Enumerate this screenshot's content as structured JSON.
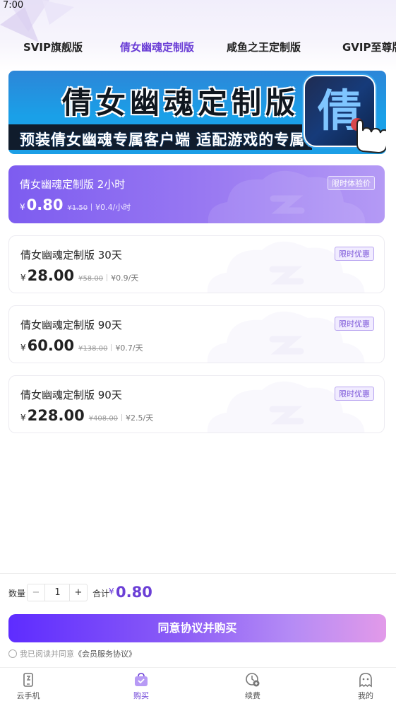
{
  "status_bar": {
    "time": "7:00"
  },
  "tabs": [
    {
      "label": "SVIP旗舰版",
      "active": false
    },
    {
      "label": "倩女幽魂定制版",
      "active": true
    },
    {
      "label": "咸鱼之王定制版",
      "active": false
    },
    {
      "label": "GVIP至尊版",
      "active": false
    }
  ],
  "banner": {
    "title": "倩女幽魂定制版",
    "subtitle": "预装倩女幽魂专属客户端  适配游戏的专属机型",
    "icon_char": "倩"
  },
  "plans": [
    {
      "name": "倩女幽魂定制版 2小时",
      "badge": "限时体验价",
      "currency": "¥",
      "price": "0.80",
      "original": "¥1.50",
      "unit_price": "¥0.4/小时",
      "selected": true
    },
    {
      "name": "倩女幽魂定制版 30天",
      "badge": "限时优惠",
      "currency": "¥",
      "price": "28.00",
      "original": "¥58.00",
      "unit_price": "¥0.9/天",
      "selected": false
    },
    {
      "name": "倩女幽魂定制版 90天",
      "badge": "限时优惠",
      "currency": "¥",
      "price": "60.00",
      "original": "¥138.00",
      "unit_price": "¥0.7/天",
      "selected": false
    },
    {
      "name": "倩女幽魂定制版 90天",
      "badge": "限时优惠",
      "currency": "¥",
      "price": "228.00",
      "original": "¥408.00",
      "unit_price": "¥2.5/天",
      "selected": false
    }
  ],
  "purchase": {
    "quantity_label": "数量",
    "minus": "−",
    "plus": "+",
    "quantity": "1",
    "total_label": "合计",
    "total_currency": "¥",
    "total": "0.80",
    "buy_label": "同意协议并购买",
    "agree_text": "我已阅读并同意",
    "agree_link": "《会员服务协议》",
    "agreed": false
  },
  "bottom_nav": [
    {
      "label": "云手机",
      "icon": "phone-icon",
      "active": false
    },
    {
      "label": "购买",
      "icon": "shopping-bag-icon",
      "active": true
    },
    {
      "label": "续费",
      "icon": "renew-clock-icon",
      "active": false
    },
    {
      "label": "我的",
      "icon": "profile-ghost-icon",
      "active": false
    }
  ],
  "colors": {
    "accent": "#6b3fd6",
    "card_selected_start": "#7d5cf0",
    "card_selected_end": "#b49af5",
    "button_start": "#5e2cff",
    "button_end": "#e29ae9"
  }
}
